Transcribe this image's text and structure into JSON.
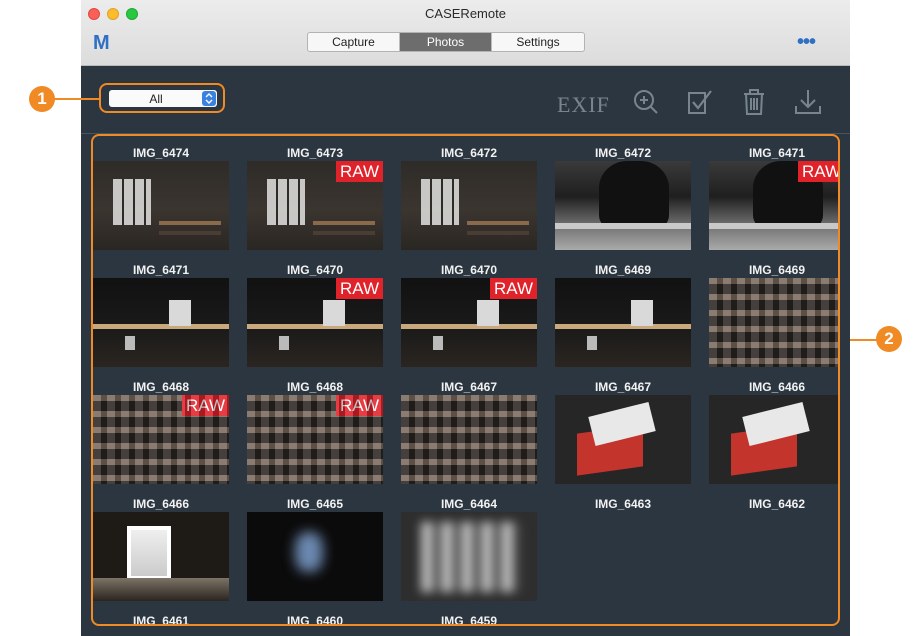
{
  "window": {
    "title": "CASERemote",
    "logo": "M",
    "more_label": "•••"
  },
  "tabs": [
    {
      "label": "Capture",
      "active": false
    },
    {
      "label": "Photos",
      "active": true
    },
    {
      "label": "Settings",
      "active": false
    }
  ],
  "toolbar": {
    "filter_value": "All",
    "exif_label": "EXIF",
    "icons": [
      "zoom-in-icon",
      "select-check-icon",
      "trash-icon",
      "download-icon"
    ]
  },
  "photos": [
    {
      "name": "IMG_6474",
      "raw": "",
      "look": "room"
    },
    {
      "name": "IMG_6473",
      "raw": "RAW",
      "look": "room"
    },
    {
      "name": "IMG_6472",
      "raw": "",
      "look": "room"
    },
    {
      "name": "IMG_6472",
      "raw": "",
      "look": "people"
    },
    {
      "name": "IMG_6471",
      "raw": "RAW",
      "look": "people"
    },
    {
      "name": "IMG_6471",
      "raw": "",
      "look": "desk"
    },
    {
      "name": "IMG_6470",
      "raw": "RAW",
      "look": "desk"
    },
    {
      "name": "IMG_6470",
      "raw": "RAW",
      "look": "desk"
    },
    {
      "name": "IMG_6469",
      "raw": "",
      "look": "desk"
    },
    {
      "name": "IMG_6469",
      "raw": "",
      "look": "shelf"
    },
    {
      "name": "IMG_6468",
      "raw": "RAW",
      "look": "shelf"
    },
    {
      "name": "IMG_6468",
      "raw": "RAW",
      "look": "shelf"
    },
    {
      "name": "IMG_6467",
      "raw": "",
      "look": "shelf"
    },
    {
      "name": "IMG_6467",
      "raw": "",
      "look": "card"
    },
    {
      "name": "IMG_6466",
      "raw": "",
      "look": "card"
    },
    {
      "name": "IMG_6466",
      "raw": "",
      "look": "door"
    },
    {
      "name": "IMG_6465",
      "raw": "",
      "look": "blur"
    },
    {
      "name": "IMG_6464",
      "raw": "",
      "look": "blur2"
    },
    {
      "name": "IMG_6463",
      "raw": "",
      "look": "none"
    },
    {
      "name": "IMG_6462",
      "raw": "",
      "look": "none"
    },
    {
      "name": "IMG_6461",
      "raw": "",
      "look": "none"
    },
    {
      "name": "IMG_6460",
      "raw": "",
      "look": "none"
    },
    {
      "name": "IMG_6459",
      "raw": "",
      "look": "none"
    }
  ],
  "callouts": [
    "1",
    "2"
  ],
  "colors": {
    "accent_orange": "#f08a24",
    "raw_badge": "#e0232a",
    "brand_blue": "#2f6fc4",
    "panel_bg": "#2b3640"
  }
}
